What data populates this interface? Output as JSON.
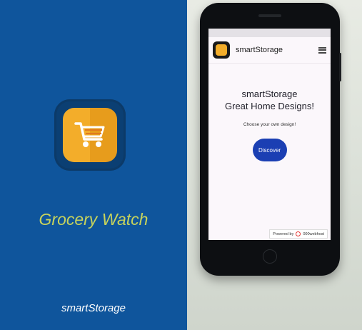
{
  "splash": {
    "app_title": "Grocery Watch",
    "footer": "smartStorage",
    "background_color": "#0f559c",
    "icon": "shopping-cart-icon"
  },
  "phone_screen": {
    "site_name": "smartStorage",
    "hero_line1": "smartStorage",
    "hero_line2": "Great Home Designs!",
    "subtitle": "Choose your own design!",
    "cta_label": "Discover",
    "powered_by_prefix": "Powered by",
    "powered_by_name": "000webhost",
    "cta_color": "#1b3fb3"
  }
}
